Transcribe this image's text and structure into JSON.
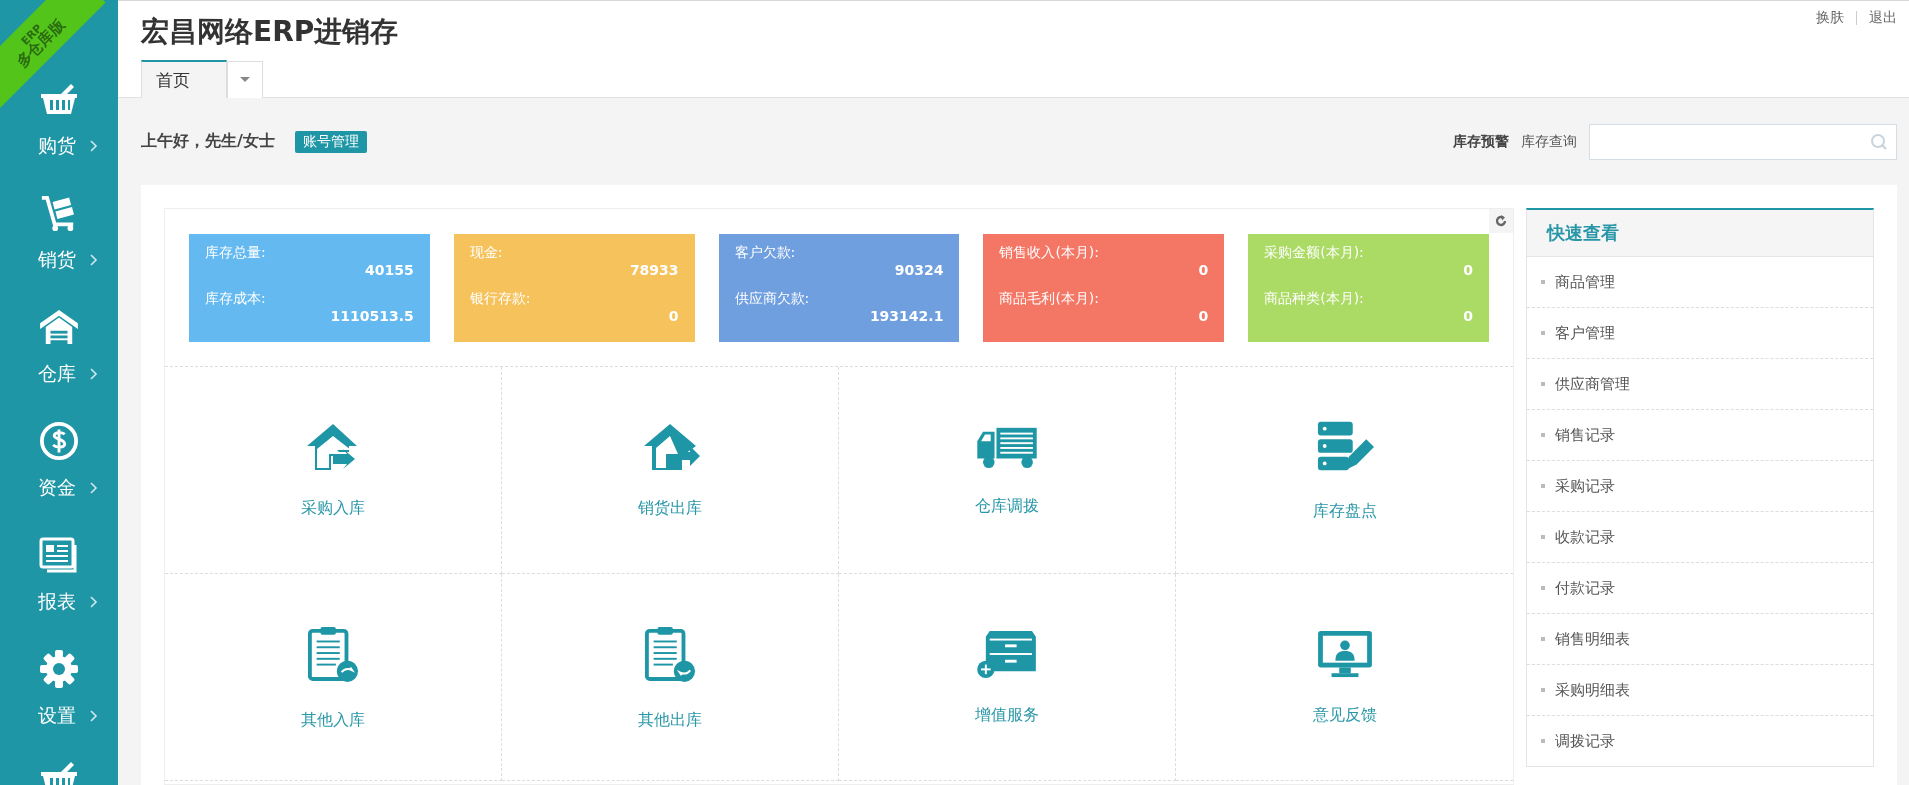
{
  "badge": {
    "line_1": "ERP",
    "line_2": "多仓库版"
  },
  "sidebar": {
    "items": [
      {
        "label": "购货"
      },
      {
        "label": "销货"
      },
      {
        "label": "仓库"
      },
      {
        "label": "资金"
      },
      {
        "label": "报表"
      },
      {
        "label": "设置"
      }
    ]
  },
  "header": {
    "title": "宏昌网络ERP进销存",
    "top_links": [
      "换肤",
      "退出"
    ],
    "tabs": [
      {
        "label": "首页",
        "selected": true
      }
    ]
  },
  "toolbar": {
    "greeting": "上午好，先生/女士",
    "account_button": "账号管理",
    "stock_alert": "库存预警",
    "stock_query": "库存查询"
  },
  "stats": [
    {
      "color": "#64b9f0",
      "rows": [
        {
          "label": "库存总量:",
          "value": "40155"
        },
        {
          "label": "库存成本:",
          "value": "1110513.5"
        }
      ]
    },
    {
      "color": "#f5c25c",
      "rows": [
        {
          "label": "现金:",
          "value": "78933"
        },
        {
          "label": "银行存款:",
          "value": "0"
        }
      ]
    },
    {
      "color": "#709fdf",
      "rows": [
        {
          "label": "客户欠款:",
          "value": "90324"
        },
        {
          "label": "供应商欠款:",
          "value": "193142.1"
        }
      ]
    },
    {
      "color": "#f47766",
      "rows": [
        {
          "label": "销售收入(本月):",
          "value": "0"
        },
        {
          "label": "商品毛利(本月):",
          "value": "0"
        }
      ]
    },
    {
      "color": "#acdb65",
      "rows": [
        {
          "label": "采购金额(本月):",
          "value": "0"
        },
        {
          "label": "商品种类(本月):",
          "value": "0"
        }
      ]
    }
  ],
  "tiles": [
    {
      "label": "采购入库"
    },
    {
      "label": "销货出库"
    },
    {
      "label": "仓库调拨"
    },
    {
      "label": "库存盘点"
    },
    {
      "label": "其他入库"
    },
    {
      "label": "其他出库"
    },
    {
      "label": "增值服务"
    },
    {
      "label": "意见反馈"
    }
  ],
  "quick_view": {
    "title": "快速查看",
    "items": [
      "商品管理",
      "客户管理",
      "供应商管理",
      "销售记录",
      "采购记录",
      "收款记录",
      "付款记录",
      "销售明细表",
      "采购明细表",
      "调拨记录"
    ]
  }
}
